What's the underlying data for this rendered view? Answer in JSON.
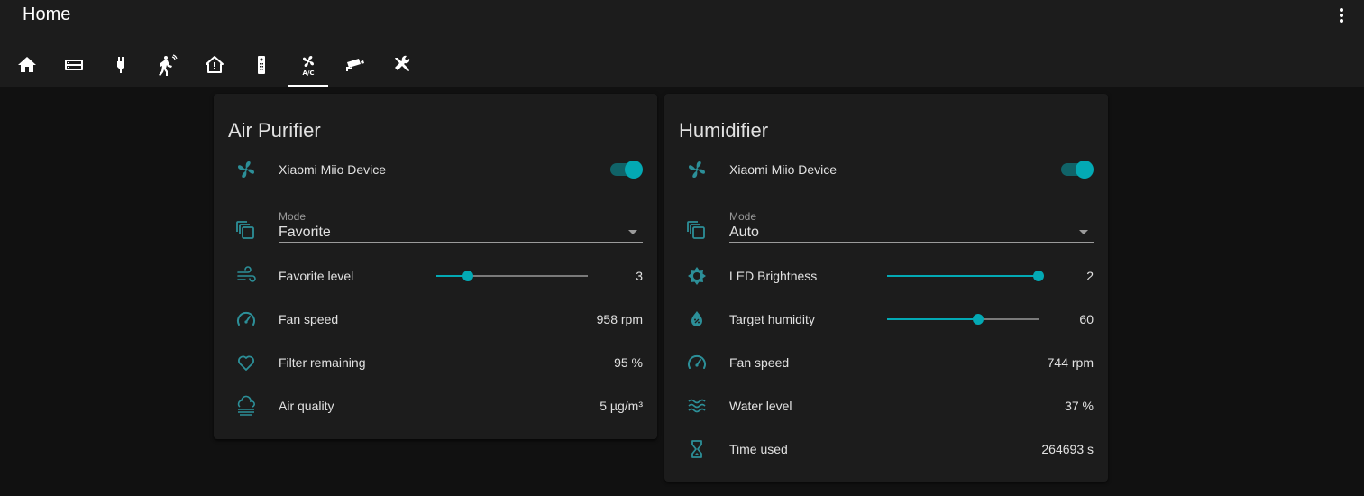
{
  "header": {
    "title": "Home"
  },
  "tabs": [
    {
      "icon": "home-icon"
    },
    {
      "icon": "server-icon"
    },
    {
      "icon": "power-plug-icon"
    },
    {
      "icon": "motion-sensor-icon"
    },
    {
      "icon": "home-alert-icon"
    },
    {
      "icon": "remote-icon"
    },
    {
      "icon": "air-conditioner-icon",
      "active": true
    },
    {
      "icon": "cctv-icon"
    },
    {
      "icon": "tools-icon"
    }
  ],
  "accent_color": "#03a9b4",
  "air_purifier": {
    "title": "Air Purifier",
    "device_label": "Xiaomi Miio Device",
    "device_on": true,
    "mode_caption": "Mode",
    "mode_value": "Favorite",
    "favorite_level": {
      "label": "Favorite level",
      "value": "3",
      "fraction": 0.21
    },
    "fan_speed": {
      "label": "Fan speed",
      "value": "958 rpm"
    },
    "filter_remaining": {
      "label": "Filter remaining",
      "value": "95 %"
    },
    "air_quality": {
      "label": "Air quality",
      "value": "5 µg/m³"
    }
  },
  "humidifier": {
    "title": "Humidifier",
    "device_label": "Xiaomi Miio Device",
    "device_on": true,
    "mode_caption": "Mode",
    "mode_value": "Auto",
    "led_brightness": {
      "label": "LED Brightness",
      "value": "2",
      "fraction": 1.0
    },
    "target_humidity": {
      "label": "Target humidity",
      "value": "60",
      "fraction": 0.6
    },
    "fan_speed": {
      "label": "Fan speed",
      "value": "744 rpm"
    },
    "water_level": {
      "label": "Water level",
      "value": "37 %"
    },
    "time_used": {
      "label": "Time used",
      "value": "264693 s"
    }
  }
}
